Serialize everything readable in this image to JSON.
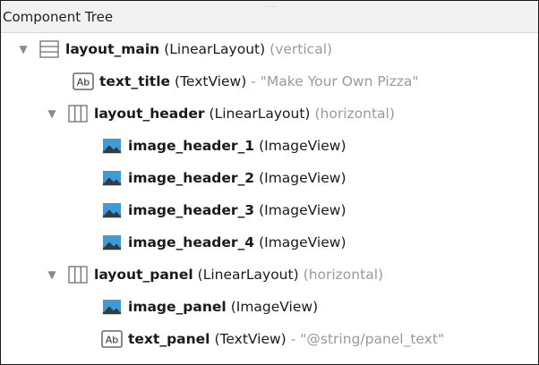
{
  "panel": {
    "title": "Component Tree"
  },
  "tree": [
    {
      "toggle": "▼",
      "icon": "vertical-linear-layout-icon",
      "name": "layout_main",
      "type": "(LinearLayout)",
      "extra": "(vertical)"
    },
    {
      "toggle": "",
      "icon": "text-view-icon",
      "name": "text_title",
      "type": "(TextView)",
      "extra": "- \"Make Your Own Pizza\""
    },
    {
      "toggle": "▼",
      "icon": "horizontal-linear-layout-icon",
      "name": "layout_header",
      "type": "(LinearLayout)",
      "extra": "(horizontal)"
    },
    {
      "toggle": "",
      "icon": "image-view-icon",
      "name": "image_header_1",
      "type": "(ImageView)",
      "extra": ""
    },
    {
      "toggle": "",
      "icon": "image-view-icon",
      "name": "image_header_2",
      "type": "(ImageView)",
      "extra": ""
    },
    {
      "toggle": "",
      "icon": "image-view-icon",
      "name": "image_header_3",
      "type": "(ImageView)",
      "extra": ""
    },
    {
      "toggle": "",
      "icon": "image-view-icon",
      "name": "image_header_4",
      "type": "(ImageView)",
      "extra": ""
    },
    {
      "toggle": "▼",
      "icon": "horizontal-linear-layout-icon",
      "name": "layout_panel",
      "type": "(LinearLayout)",
      "extra": "(horizontal)"
    },
    {
      "toggle": "",
      "icon": "image-view-icon",
      "name": "image_panel",
      "type": "(ImageView)",
      "extra": ""
    },
    {
      "toggle": "",
      "icon": "text-view-icon",
      "name": "text_panel",
      "type": "(TextView)",
      "extra": "- \"@string/panel_text\""
    }
  ]
}
